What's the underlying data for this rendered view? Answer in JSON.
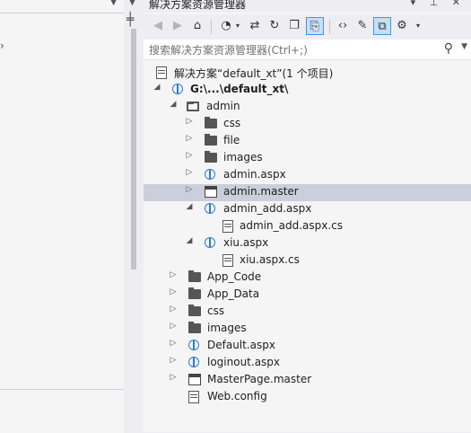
{
  "panel": {
    "title": "解决方案资源管理器",
    "pin_glyph": "▾ ⊕ ✕"
  },
  "toolbar": {
    "back_icon": "back-icon",
    "forward_icon": "forward-icon",
    "home_icon": "home-icon",
    "history_icon": "history-icon",
    "sync_icon": "sync-icon",
    "refresh_icon": "refresh-icon",
    "collapse_icon": "collapse-all-icon",
    "show_files_icon": "show-all-files-icon",
    "code_icon": "view-code-icon",
    "properties_icon": "properties-icon",
    "preview_icon": "preview-icon",
    "class_view_icon": "class-view-icon"
  },
  "search": {
    "placeholder": "搜索解决方案资源管理器(Ctrl+;)"
  },
  "tree": {
    "solution": "解决方案“default_xt”(1 个项目)",
    "project": "G:\\...\\default_xt\\",
    "items": [
      {
        "label": "admin"
      },
      {
        "label": "css"
      },
      {
        "label": "file"
      },
      {
        "label": "images"
      },
      {
        "label": "admin.aspx"
      },
      {
        "label": "admin.master"
      },
      {
        "label": "admin_add.aspx"
      },
      {
        "label": "admin_add.aspx.cs"
      },
      {
        "label": "xiu.aspx"
      },
      {
        "label": "xiu.aspx.cs"
      },
      {
        "label": "App_Code"
      },
      {
        "label": "App_Data"
      },
      {
        "label": "css"
      },
      {
        "label": "images"
      },
      {
        "label": "Default.aspx"
      },
      {
        "label": "loginout.aspx"
      },
      {
        "label": "MasterPage.master"
      },
      {
        "label": "Web.config"
      }
    ]
  },
  "colors": {
    "selection": "#cccedb",
    "background": "#f5f5f5",
    "accent": "#3399ff"
  }
}
